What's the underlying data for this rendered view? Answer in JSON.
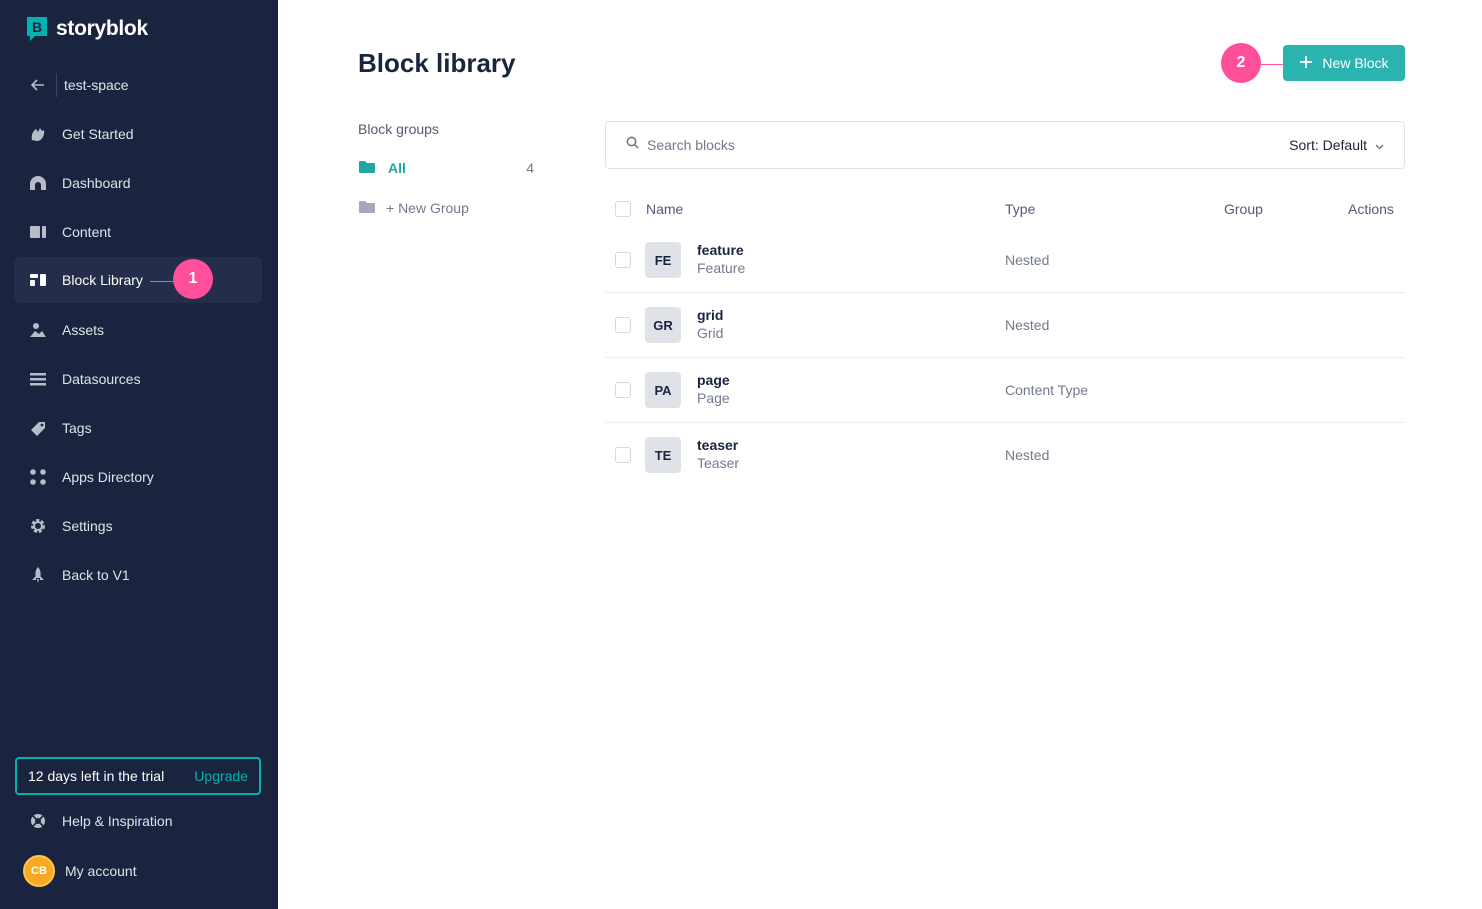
{
  "brand": {
    "name": "storyblok",
    "logo_letter": "B",
    "accent": "#00b3b0",
    "sidebar_bg": "#1b243f"
  },
  "sidebar": {
    "space_name": "test-space",
    "items": [
      {
        "label": "Get Started",
        "icon": "hand-wave-icon"
      },
      {
        "label": "Dashboard",
        "icon": "dashboard-icon"
      },
      {
        "label": "Content",
        "icon": "content-icon"
      },
      {
        "label": "Block Library",
        "icon": "block-library-icon",
        "active": true
      },
      {
        "label": "Assets",
        "icon": "assets-icon"
      },
      {
        "label": "Datasources",
        "icon": "datasources-icon"
      },
      {
        "label": "Tags",
        "icon": "tag-icon"
      },
      {
        "label": "Apps Directory",
        "icon": "apps-icon"
      },
      {
        "label": "Settings",
        "icon": "gear-icon"
      },
      {
        "label": "Back to V1",
        "icon": "rocket-icon"
      }
    ],
    "trial": {
      "text": "12 days left in the trial",
      "upgrade_label": "Upgrade"
    },
    "help_label": "Help & Inspiration",
    "account": {
      "initials": "CB",
      "label": "My account"
    }
  },
  "markers": {
    "one": "1",
    "two": "2",
    "color": "#ff4f9a"
  },
  "main": {
    "title": "Block library",
    "new_block_label": "New Block",
    "groups": {
      "title": "Block groups",
      "all_label": "All",
      "all_count": "4",
      "new_group_label": "+ New Group"
    },
    "search": {
      "placeholder": "Search blocks",
      "sort_label": "Sort: Default"
    },
    "table": {
      "headers": {
        "name": "Name",
        "type": "Type",
        "group": "Group",
        "actions": "Actions"
      },
      "rows": [
        {
          "abbr": "FE",
          "name": "feature",
          "display": "Feature",
          "type": "Nested"
        },
        {
          "abbr": "GR",
          "name": "grid",
          "display": "Grid",
          "type": "Nested"
        },
        {
          "abbr": "PA",
          "name": "page",
          "display": "Page",
          "type": "Content Type"
        },
        {
          "abbr": "TE",
          "name": "teaser",
          "display": "Teaser",
          "type": "Nested"
        }
      ]
    }
  }
}
